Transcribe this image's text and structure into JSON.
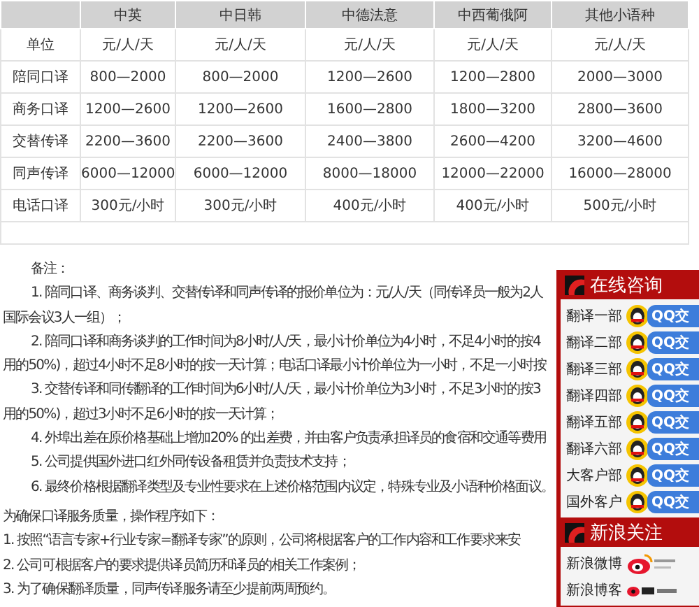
{
  "table": {
    "columns": [
      "中英",
      "中日韩",
      "中德法意",
      "中西葡俄阿",
      "其他小语种"
    ],
    "rows": [
      {
        "label": "单位",
        "cells": [
          "元/人/天",
          "元/人/天",
          "元/人/天",
          "元/人/天",
          "元/人/天"
        ]
      },
      {
        "label": "陪同口译",
        "cells": [
          "800—2000",
          "800—2000",
          "1200—2600",
          "1200—2800",
          "2000—3000"
        ]
      },
      {
        "label": "商务口译",
        "cells": [
          "1200—2600",
          "1200—2600",
          "1600—2800",
          "1800—3200",
          "2800—3600"
        ]
      },
      {
        "label": "交替传译",
        "cells": [
          "2200—3600",
          "2200—3600",
          "2400—3800",
          "2600—4200",
          "3200—4600"
        ]
      },
      {
        "label": "同声传译",
        "cells": [
          "6000—12000",
          "6000—12000",
          "8000—18000",
          "12000—22000",
          "16000—28000"
        ]
      },
      {
        "label": "电话口译",
        "cells": [
          "300元/小时",
          "300元/小时",
          "400元/小时",
          "400元/小时",
          "500元/小时"
        ]
      }
    ]
  },
  "notes": {
    "title": "备注：",
    "lines": [
      {
        "kind": "item",
        "text": "1. 陪同口译、商务谈判、交替传译和同声传译的报价单位为：元/人/天（同传译员一般为2人"
      },
      {
        "kind": "continuation",
        "text": "国际会议3人一组）；"
      },
      {
        "kind": "item",
        "text": "2. 陪同口译和商务谈判的工作时间为8小时/人/天，最小计价单位为4小时，不足4小时的按4"
      },
      {
        "kind": "continuation",
        "text": "用的50%)，超过4小时不足8小时的按一天计算；电话口译最小计价单位为一小时，不足一小时按"
      },
      {
        "kind": "item",
        "text": "3. 交替传译和同传翻译的工作时间为6小时/人/天，最小计价单位为3小时，不足3小时的按3"
      },
      {
        "kind": "continuation",
        "text": "用的50%)，超过3小时不足6小时的按一天计算；"
      },
      {
        "kind": "item",
        "text": "4. 外埠出差在原价格基础上增加20% 的出差费，并由客户负责承担译员的食宿和交通等费用"
      },
      {
        "kind": "item",
        "text": "5. 公司提供国外进口红外同传设备租赁并负责技术支持；"
      },
      {
        "kind": "item",
        "text": "6. 最终价格根据翻译类型及专业性要求在上述价格范围内议定，特殊专业及小语种价格面议。"
      }
    ]
  },
  "procedure": {
    "title": "为确保口译服务质量，操作程序如下：",
    "lines": [
      "1. 按照“语言专家+行业专家=翻译专家”的原则，公司将根据客户的工作内容和工作要求来安",
      "2. 公司可根据客户的要求提供译员简历和译员的相关工作案例；",
      "3. 为了确保翻译质量，同声传译服务请至少提前两周预约。"
    ]
  },
  "widget": {
    "title": "在线咨询",
    "contacts": [
      {
        "name": "翻译一部",
        "button": "QQ交"
      },
      {
        "name": "翻译二部",
        "button": "QQ交"
      },
      {
        "name": "翻译三部",
        "button": "QQ交"
      },
      {
        "name": "翻译四部",
        "button": "QQ交"
      },
      {
        "name": "翻译五部",
        "button": "QQ交"
      },
      {
        "name": "翻译六部",
        "button": "QQ交"
      },
      {
        "name": "大客户部",
        "button": "QQ交"
      },
      {
        "name": "国外客户",
        "button": "QQ交"
      }
    ],
    "follow_title": "新浪关注",
    "follow": [
      {
        "name": "新浪微博",
        "kind": "weibo"
      },
      {
        "name": "新浪博客",
        "kind": "blog"
      }
    ]
  }
}
